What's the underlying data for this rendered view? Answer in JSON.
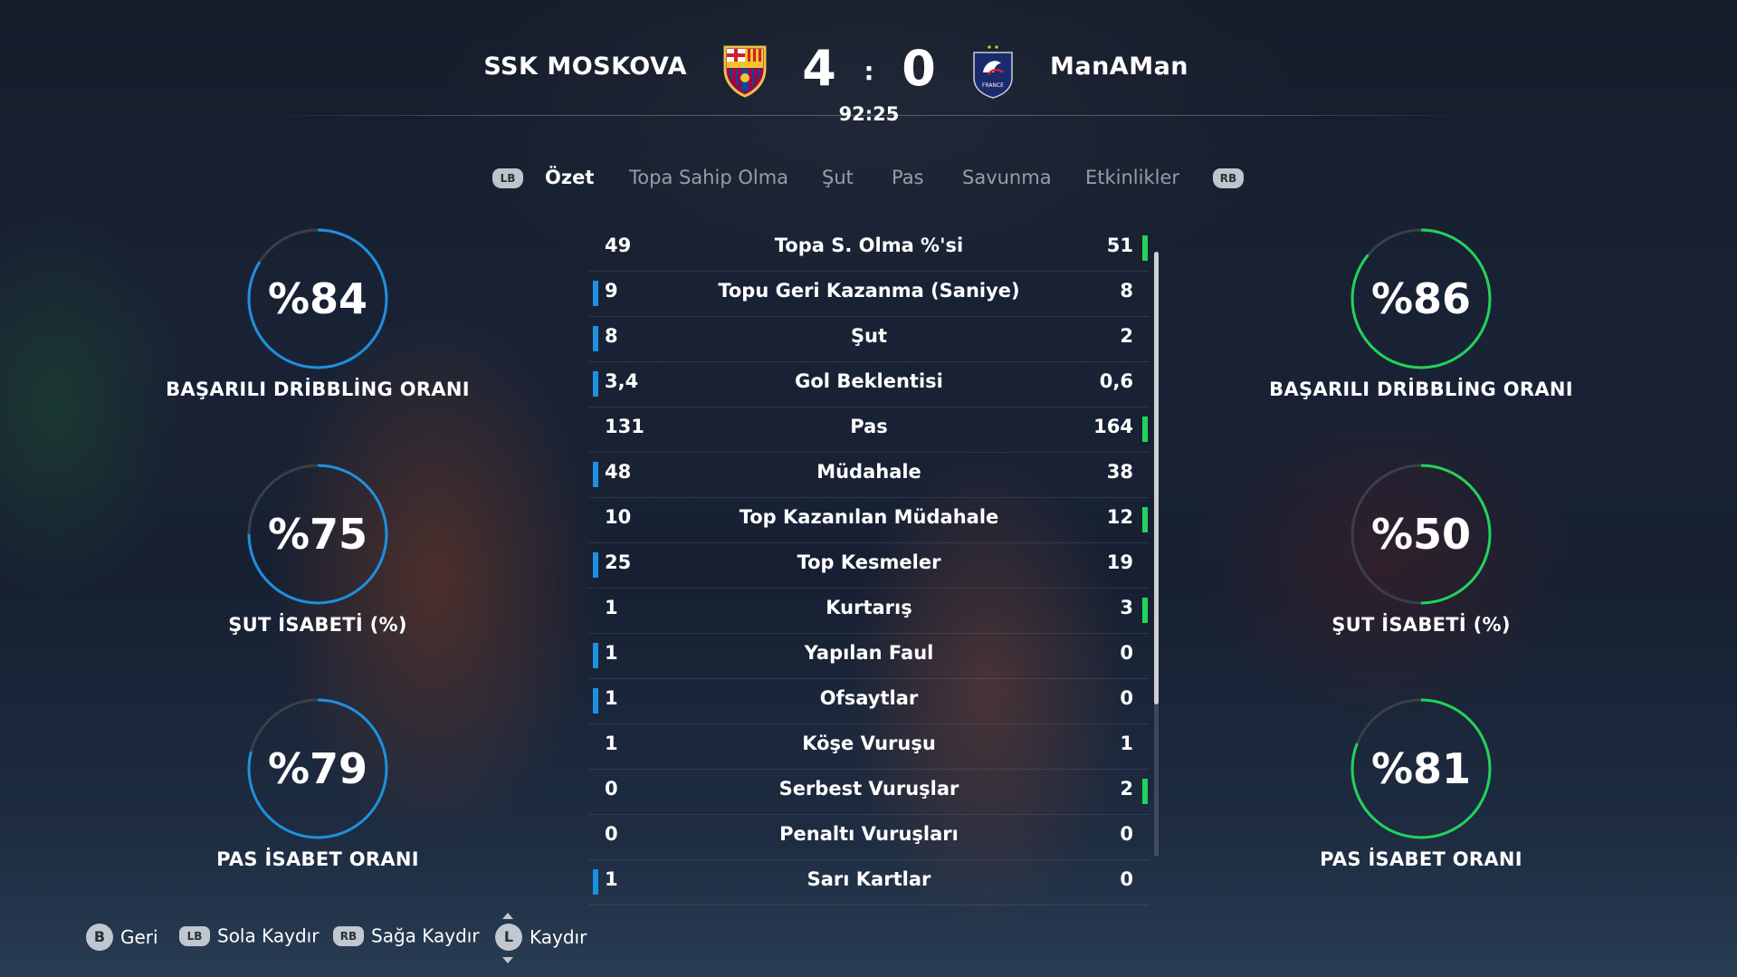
{
  "match": {
    "home_team": "SSK MOSKOVA",
    "away_team": "ManAMan",
    "home_score": "4",
    "separator": ":",
    "away_score": "0",
    "clock": "92:25",
    "home_crest_text": "FCB",
    "away_crest_text": "FRANCE"
  },
  "tabs": {
    "prev_button": "LB",
    "next_button": "RB",
    "items": [
      "Özet",
      "Topa Sahip Olma",
      "Şut",
      "Pas",
      "Savunma",
      "Etkinlikler"
    ],
    "active": "Özet"
  },
  "home_rings": [
    {
      "value": "%84",
      "percent": 84,
      "label": "BAŞARILI DRİBBLİNG ORANI"
    },
    {
      "value": "%75",
      "percent": 75,
      "label": "ŞUT İSABETİ (%)"
    },
    {
      "value": "%79",
      "percent": 79,
      "label": "PAS İSABET ORANI"
    }
  ],
  "away_rings": [
    {
      "value": "%86",
      "percent": 86,
      "label": "BAŞARILI DRİBBLİNG ORANI"
    },
    {
      "value": "%50",
      "percent": 50,
      "label": "ŞUT İSABETİ (%)"
    },
    {
      "value": "%81",
      "percent": 81,
      "label": "PAS İSABET ORANI"
    }
  ],
  "colors": {
    "home_accent": "#1f8fe0",
    "away_accent": "#22d35a",
    "ring_track": "#3a3f48"
  },
  "stats": [
    {
      "home": "49",
      "label": "Topa S. Olma %'si",
      "away": "51",
      "leader": "away"
    },
    {
      "home": "9",
      "label": "Topu Geri Kazanma (Saniye)",
      "away": "8",
      "leader": "home"
    },
    {
      "home": "8",
      "label": "Şut",
      "away": "2",
      "leader": "home"
    },
    {
      "home": "3,4",
      "label": "Gol Beklentisi",
      "away": "0,6",
      "leader": "home"
    },
    {
      "home": "131",
      "label": "Pas",
      "away": "164",
      "leader": "away"
    },
    {
      "home": "48",
      "label": "Müdahale",
      "away": "38",
      "leader": "home"
    },
    {
      "home": "10",
      "label": "Top Kazanılan Müdahale",
      "away": "12",
      "leader": "away"
    },
    {
      "home": "25",
      "label": "Top Kesmeler",
      "away": "19",
      "leader": "home"
    },
    {
      "home": "1",
      "label": "Kurtarış",
      "away": "3",
      "leader": "away"
    },
    {
      "home": "1",
      "label": "Yapılan Faul",
      "away": "0",
      "leader": "home"
    },
    {
      "home": "1",
      "label": "Ofsaytlar",
      "away": "0",
      "leader": "home"
    },
    {
      "home": "1",
      "label": "Köşe Vuruşu",
      "away": "1",
      "leader": "none"
    },
    {
      "home": "0",
      "label": "Serbest Vuruşlar",
      "away": "2",
      "leader": "away"
    },
    {
      "home": "0",
      "label": "Penaltı Vuruşları",
      "away": "0",
      "leader": "none"
    },
    {
      "home": "1",
      "label": "Sarı Kartlar",
      "away": "0",
      "leader": "home"
    }
  ],
  "footer": {
    "back": {
      "glyph": "B",
      "label": "Geri"
    },
    "scroll_left": {
      "glyph": "LB",
      "label": "Sola Kaydır"
    },
    "scroll_right": {
      "glyph": "RB",
      "label": "Sağa Kaydır"
    },
    "scroll": {
      "glyph": "L",
      "label": "Kaydır"
    }
  }
}
